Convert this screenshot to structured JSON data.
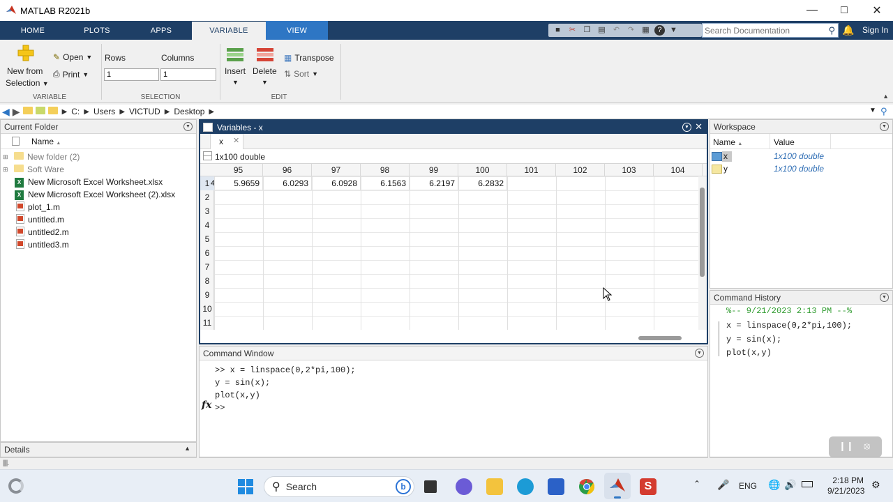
{
  "window": {
    "title": "MATLAB R2021b"
  },
  "tabs": [
    {
      "label": "HOME"
    },
    {
      "label": "PLOTS"
    },
    {
      "label": "APPS"
    },
    {
      "label": "VARIABLE"
    },
    {
      "label": "VIEW"
    }
  ],
  "search_doc": {
    "placeholder": "Search Documentation"
  },
  "signin": "Sign In",
  "ribbon": {
    "new_from": "New from",
    "selection": "Selection",
    "open": "Open",
    "print": "Print",
    "rows_label": "Rows",
    "columns_label": "Columns",
    "rows_value": "1",
    "columns_value": "1",
    "insert": "Insert",
    "delete": "Delete",
    "transpose": "Transpose",
    "sort": "Sort",
    "groups": {
      "variable": "VARIABLE",
      "selection": "SELECTION",
      "edit": "EDIT"
    }
  },
  "address": {
    "path": [
      "C:",
      "Users",
      "VICTUD",
      "Desktop"
    ]
  },
  "current_folder": {
    "title": "Current Folder",
    "name_header": "Name",
    "items": [
      {
        "name": "New folder (2)",
        "type": "folder"
      },
      {
        "name": "Soft Ware",
        "type": "folder"
      },
      {
        "name": "New Microsoft Excel Worksheet.xlsx",
        "type": "xlsx"
      },
      {
        "name": "New Microsoft Excel Worksheet (2).xlsx",
        "type": "xlsx"
      },
      {
        "name": "plot_1.m",
        "type": "m"
      },
      {
        "name": "untitled.m",
        "type": "m"
      },
      {
        "name": "untitled2.m",
        "type": "m"
      },
      {
        "name": "untitled3.m",
        "type": "m"
      }
    ]
  },
  "details": {
    "title": "Details"
  },
  "variables": {
    "title": "Variables - x",
    "tab": "x",
    "info": "1x100 double",
    "columns": [
      "95",
      "96",
      "97",
      "98",
      "99",
      "100",
      "101",
      "102",
      "103",
      "104"
    ],
    "rows": [
      "1",
      "2",
      "3",
      "4",
      "5",
      "6",
      "7",
      "8",
      "9",
      "10",
      "11"
    ],
    "row1_prefix": "4",
    "row1_values": [
      "5.9659",
      "6.0293",
      "6.0928",
      "6.1563",
      "6.2197",
      "6.2832",
      "",
      "",
      "",
      ""
    ]
  },
  "command_window": {
    "title": "Command Window",
    "lines": [
      ">> x = linspace(0,2*pi,100);",
      "y = sin(x);",
      "plot(x,y)"
    ],
    "prompt": ">>",
    "fx": "fx"
  },
  "workspace": {
    "title": "Workspace",
    "name_header": "Name",
    "value_header": "Value",
    "vars": [
      {
        "name": "x",
        "value": "1x100 double"
      },
      {
        "name": "y",
        "value": "1x100 double"
      }
    ]
  },
  "history": {
    "title": "Command History",
    "session": "%-- 9/21/2023 2:13 PM --%",
    "lines": [
      "x = linspace(0,2*pi,100);",
      "y = sin(x);",
      "plot(x,y)"
    ]
  },
  "taskbar": {
    "search": "Search",
    "lang": "ENG",
    "time": "2:18 PM",
    "date": "9/21/2023"
  }
}
